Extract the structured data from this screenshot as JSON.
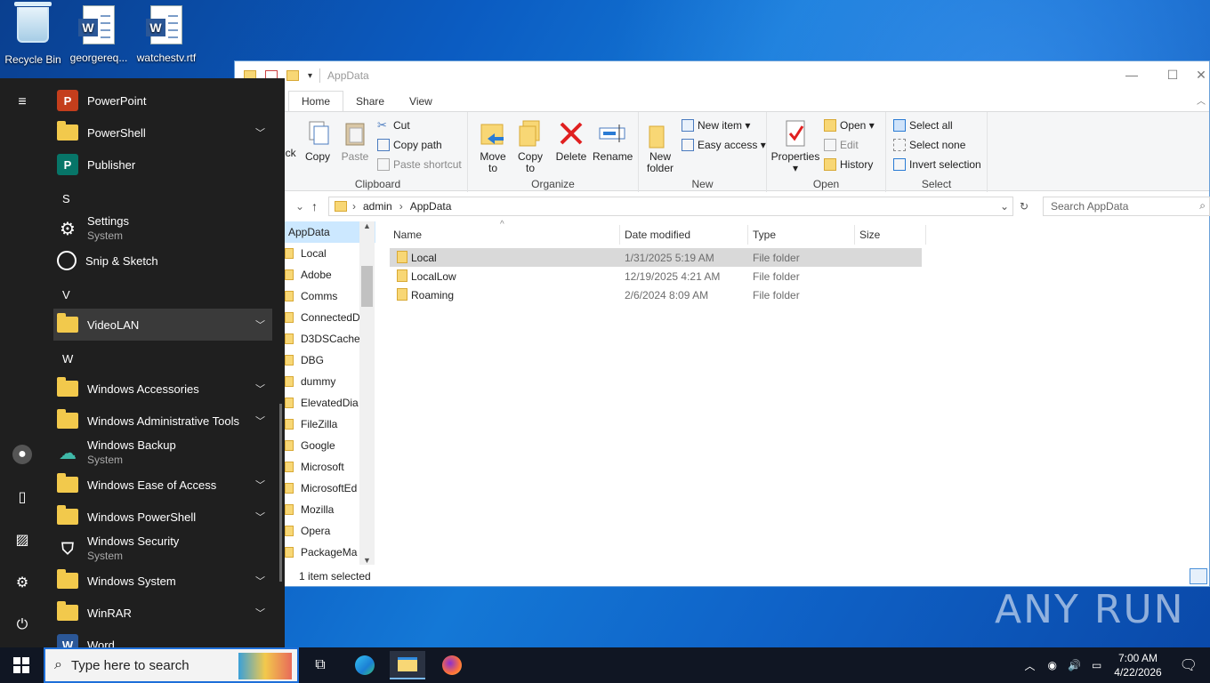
{
  "desktop": {
    "icons": [
      {
        "label": "Recycle Bin"
      },
      {
        "label": "georgereq..."
      },
      {
        "label": "watchestv.rtf"
      }
    ],
    "watermark": "ANY RUN"
  },
  "explorer": {
    "title": "AppData",
    "tabs": [
      "Home",
      "Share",
      "View"
    ],
    "ribbon": {
      "clipboard": {
        "label": "Clipboard",
        "pin": "ick",
        "copy": "Copy",
        "paste": "Paste",
        "cut": "Cut",
        "copy_path": "Copy path",
        "paste_shortcut": "Paste shortcut"
      },
      "organize": {
        "label": "Organize",
        "move_to": "Move to",
        "copy_to": "Copy to",
        "delete": "Delete",
        "rename": "Rename"
      },
      "new": {
        "label": "New",
        "new_folder": "New folder",
        "new_item": "New item",
        "easy_access": "Easy access"
      },
      "open": {
        "label": "Open",
        "properties": "Properties",
        "open": "Open",
        "edit": "Edit",
        "history": "History"
      },
      "select": {
        "label": "Select",
        "select_all": "Select all",
        "select_none": "Select none",
        "invert": "Invert selection"
      }
    },
    "breadcrumb": [
      "admin",
      "AppData"
    ],
    "search_placeholder": "Search AppData",
    "nav_items": [
      "AppData",
      "Local",
      "Adobe",
      "Comms",
      "ConnectedD",
      "D3DSCache",
      "DBG",
      "dummy",
      "ElevatedDia",
      "FileZilla",
      "Google",
      "Microsoft",
      "MicrosoftEd",
      "Mozilla",
      "Opera",
      "PackageMa"
    ],
    "columns": [
      "Name",
      "Date modified",
      "Type",
      "Size"
    ],
    "files": [
      {
        "name": "Local",
        "date": "1/31/2025 5:19 AM",
        "type": "File folder",
        "size": ""
      },
      {
        "name": "LocalLow",
        "date": "12/19/2025 4:21 AM",
        "type": "File folder",
        "size": ""
      },
      {
        "name": "Roaming",
        "date": "2/6/2024 8:09 AM",
        "type": "File folder",
        "size": ""
      }
    ],
    "status": "1 item selected"
  },
  "start_menu": {
    "apps": [
      {
        "label": "PowerPoint"
      },
      {
        "label": "PowerShell"
      },
      {
        "label": "Publisher"
      },
      {
        "letter": "S"
      },
      {
        "label": "Settings",
        "sub": "System"
      },
      {
        "label": "Snip & Sketch"
      },
      {
        "letter": "V"
      },
      {
        "label": "VideoLAN"
      },
      {
        "letter": "W"
      },
      {
        "label": "Windows Accessories"
      },
      {
        "label": "Windows Administrative Tools"
      },
      {
        "label": "Windows Backup",
        "sub": "System"
      },
      {
        "label": "Windows Ease of Access"
      },
      {
        "label": "Windows PowerShell"
      },
      {
        "label": "Windows Security",
        "sub": "System"
      },
      {
        "label": "Windows System"
      },
      {
        "label": "WinRAR"
      },
      {
        "label": "Word"
      }
    ]
  },
  "taskbar": {
    "search_placeholder": "Type here to search",
    "time": "7:00 AM",
    "date": "4/22/2026"
  }
}
